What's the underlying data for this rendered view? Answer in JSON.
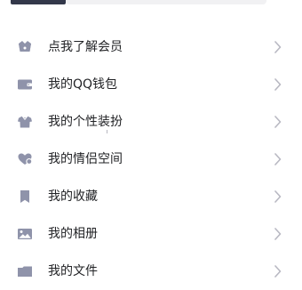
{
  "menu": {
    "items": [
      {
        "label": "点我了解会员",
        "icon": "vip-basket-icon"
      },
      {
        "label": "我的QQ钱包",
        "icon": "wallet-icon"
      },
      {
        "label": "我的个性装扮",
        "icon": "shirt-icon"
      },
      {
        "label": "我的情侣空间",
        "icon": "heart-icon"
      },
      {
        "label": "我的收藏",
        "icon": "bookmark-icon"
      },
      {
        "label": "我的相册",
        "icon": "photo-icon"
      },
      {
        "label": "我的文件",
        "icon": "folder-icon"
      }
    ]
  },
  "colors": {
    "icon": "#8f93aa",
    "chevron": "#b8b8c2",
    "text": "#222326",
    "top_tab": "#33384a",
    "top_card": "#f1f1f3"
  }
}
